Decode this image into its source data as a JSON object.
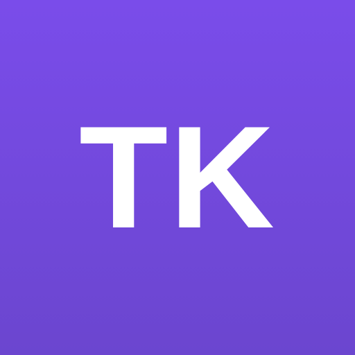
{
  "avatar": {
    "initials": "TK",
    "colors": {
      "background_top": "#7a4cea",
      "background_bottom": "#6b46cf",
      "text": "#ffffff"
    }
  }
}
